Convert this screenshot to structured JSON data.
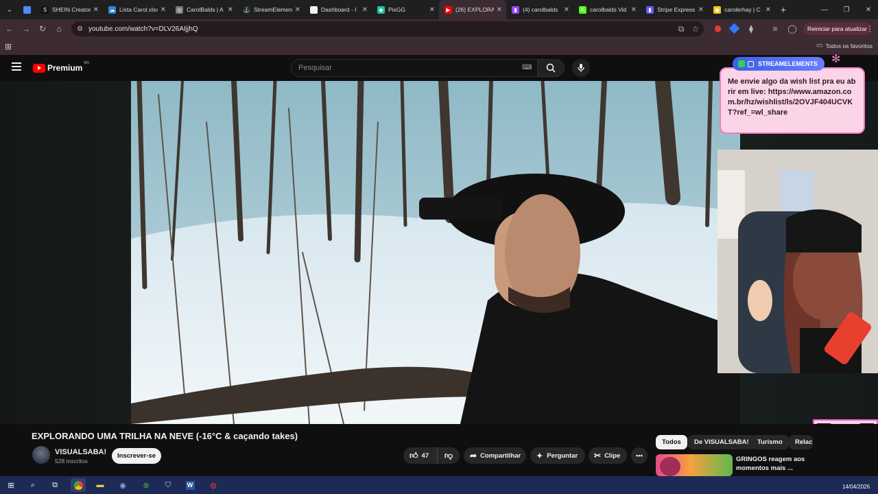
{
  "browser": {
    "tabs": [
      {
        "label": "",
        "color": "#4a8cff"
      },
      {
        "label": "SHEIN Creator",
        "color": "#111111",
        "glyph": "S"
      },
      {
        "label": "Lista Carol.xlsx",
        "color": "#2d88d8",
        "glyph": "☁"
      },
      {
        "label": "CarolBalds | A",
        "color": "#777777",
        "glyph": "◎"
      },
      {
        "label": "StreamElemen",
        "color": "#2b2b2b",
        "glyph": "⚓"
      },
      {
        "label": "Dashboard - I",
        "color": "#eeeeee",
        "glyph": "◯"
      },
      {
        "label": "PixGG",
        "color": "#19c39a",
        "glyph": "◆"
      },
      {
        "label": "(26) EXPLORA",
        "color": "#ff0000",
        "glyph": "▶",
        "active": true
      },
      {
        "label": "(4) carolbalds",
        "color": "#9146ff",
        "glyph": "▮"
      },
      {
        "label": "carolbalds Vid",
        "color": "#53fc18",
        "glyph": "K"
      },
      {
        "label": "Stripe Express",
        "color": "#635bff",
        "glyph": "▮"
      },
      {
        "label": "carolerhay | C",
        "color": "#f0c419",
        "glyph": "◉"
      }
    ],
    "address": "youtube.com/watch?v=DLV26AIjjhQ",
    "restart_label": "Reiniciar para atualizar",
    "bookmarks_label": "Todos os favoritos"
  },
  "youtube": {
    "brand": "Premium",
    "country": "BR",
    "search_placeholder": "Pesquisar",
    "video_title": "EXPLORANDO UMA TRILHA NA NEVE (-16°C & caçando takes)",
    "channel": "VISUALSABA!",
    "subscribers": "528 inscritos",
    "subscribe_label": "Inscrever-se",
    "likes": "47",
    "share_label": "Compartilhar",
    "ask_label": "Perguntar",
    "clip_label": "Clipe",
    "chips": [
      "Todos",
      "De VISUALSABA!",
      "Turismo",
      "Relac"
    ],
    "rec_title": "GRINGOS reagem aos momentos mais ..."
  },
  "overlay": {
    "se_tag": "STREAMELEMENTS",
    "se_message": "Me envie algo da wish list pra eu abrir em live: https://www.amazon.com.br/hz/wishlist/ls/2OVJF404UCVKT?ref_=wl_share"
  },
  "taskbar": {
    "date": "14/04/2026"
  }
}
